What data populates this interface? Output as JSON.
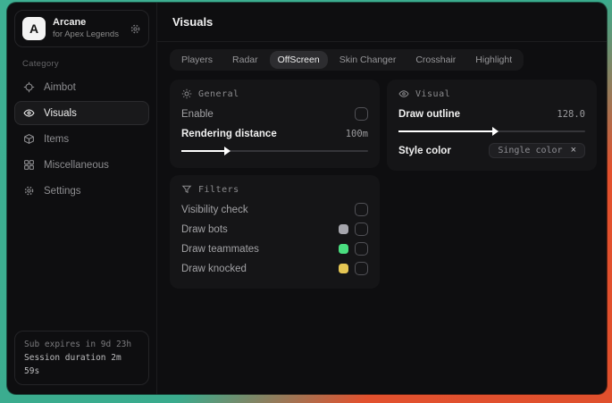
{
  "app": {
    "name": "Arcane",
    "subtitle": "for Apex Legends",
    "logo_letter": "A"
  },
  "sidebar": {
    "category_label": "Category",
    "items": [
      {
        "label": "Aimbot"
      },
      {
        "label": "Visuals"
      },
      {
        "label": "Items"
      },
      {
        "label": "Miscellaneous"
      },
      {
        "label": "Settings"
      }
    ],
    "status_line1": "Sub expires in 9d 23h",
    "status_line2": "Session duration 2m 59s"
  },
  "main": {
    "title": "Visuals",
    "selected_tab": "OffScreen",
    "tabs": [
      {
        "label": "Players"
      },
      {
        "label": "Radar"
      },
      {
        "label": "OffScreen"
      },
      {
        "label": "Skin Changer"
      },
      {
        "label": "Crosshair"
      },
      {
        "label": "Highlight"
      }
    ],
    "general": {
      "title": "General",
      "enable_label": "Enable",
      "distance_label": "Rendering distance",
      "distance_value": "100m",
      "distance_percent": 23
    },
    "filters": {
      "title": "Filters",
      "rows": [
        {
          "label": "Visibility check"
        },
        {
          "label": "Draw bots",
          "swatch": "#a6a6ad"
        },
        {
          "label": "Draw teammates",
          "swatch": "#4ade80"
        },
        {
          "label": "Draw knocked",
          "swatch": "#e5c654"
        }
      ]
    },
    "visual": {
      "title": "Visual",
      "outline_label": "Draw outline",
      "outline_value": "128.0",
      "outline_percent": 50,
      "style_label": "Style color",
      "style_tag": "Single color",
      "style_tag_close": "×"
    }
  },
  "colors": {
    "desktop_teal": "#3aab8d",
    "desktop_orange": "#e2512e",
    "swatch_gray": "#a6a6ad",
    "swatch_green": "#4ade80",
    "swatch_yellow": "#e5c654"
  }
}
